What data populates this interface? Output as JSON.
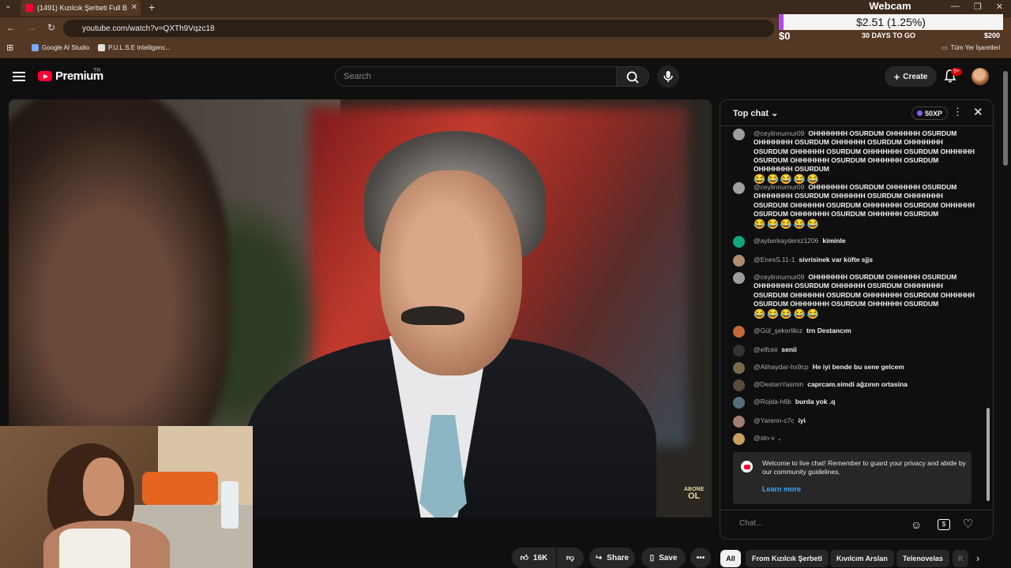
{
  "browser": {
    "tab_title": "(1491) Kızılcık Şerbeti Full B",
    "url": "youtube.com/watch?v=QXTh9Vqzc18",
    "bookmarks": [
      {
        "label": "Google AI Studio"
      },
      {
        "label": "P.U.L.S.E Intelligenc..."
      }
    ],
    "all_bookmarks_label": "Tüm Yer İşaretleri"
  },
  "webcam_overlay": {
    "title": "Webcam",
    "goal_text": "$2.51 (1.25%)",
    "goal_min": "$0",
    "goal_days": "30 DAYS TO GO",
    "goal_max": "$200",
    "goal_progress": 0.0125
  },
  "youtube": {
    "logo_text": "Premium",
    "country_code": "TR",
    "search_placeholder": "Search",
    "create_label": "Create",
    "notification_count": "9+"
  },
  "video": {
    "watermark_top": "ABONE",
    "watermark_bottom": "OL"
  },
  "actions": {
    "likes": "16K",
    "share": "Share",
    "save": "Save"
  },
  "chat": {
    "title": "Top chat",
    "xp": "50XP",
    "messages": [
      {
        "author": "@ceylinnurnur09",
        "text": "OHHHHHHH OSURDUM OHHHHHH OSURDUM OHHHHHHH OSURDUM OHHHHHH OSURDUM OHHHHHHH OSURDUM OHHHHHH OSURDUM OHHHHHHH OSURDUM OHHHHHH OSURDUM OHHHHHHH OSURDUM OHHHHHH OSURDUM OHHHHHHH OSURDUM",
        "emoji": "😂😂😂😂😂",
        "avatar_color": "#9e9e9e"
      },
      {
        "author": "@ceylinnurnur09",
        "text": "OHHHHHHH OSURDUM OHHHHHH OSURDUM OHHHHHHH OSURDUM OHHHHHH OSURDUM OHHHHHHH OSURDUM OHHHHHH OSURDUM OHHHHHHH OSURDUM OHHHHHH OSURDUM OHHHHHHH OSURDUM OHHHHHH OSURDUM",
        "emoji": "😂😂😂😂😂",
        "avatar_color": "#9e9e9e"
      },
      {
        "author": "@ayberkaydeniz1206",
        "text": "kiminle",
        "emoji": "",
        "avatar_color": "#12a37f"
      },
      {
        "author": "@EnesS.11-1",
        "text": "sivrisinek var köfte sjjs",
        "emoji": "",
        "avatar_color": "#b08c6e"
      },
      {
        "author": "@ceylinnurnur09",
        "text": "OHHHHHHH OSURDUM OHHHHHH OSURDUM OHHHHHHH OSURDUM OHHHHHH OSURDUM OHHHHHHH OSURDUM OHHHHHH OSURDUM OHHHHHHH OSURDUM OHHHHHH OSURDUM OHHHHHHH OSURDUM OHHHHHH OSURDUM",
        "emoji": "😂😂😂😂😂",
        "avatar_color": "#9e9e9e"
      },
      {
        "author": "@Gül_şekerlikız",
        "text": "trn Destancım",
        "emoji": "",
        "avatar_color": "#c46a3a"
      },
      {
        "author": "@elfceii",
        "text": "senii",
        "emoji": "",
        "avatar_color": "#333333"
      },
      {
        "author": "@Alihaydar-hx9cp",
        "text": "He iyi bende bu sene gelcem",
        "emoji": "",
        "avatar_color": "#7a6a4a"
      },
      {
        "author": "@DestanYasmin",
        "text": "caprcam.simdi ağzının ortasina",
        "emoji": "",
        "avatar_color": "#5a4a3a"
      },
      {
        "author": "@Rojda-h6b",
        "text": "burda yok .q",
        "emoji": "",
        "avatar_color": "#546e7a"
      },
      {
        "author": "@Yarenn-c7c",
        "text": "iyi",
        "emoji": "",
        "avatar_color": "#a08070"
      },
      {
        "author": "@sln-v",
        "text": ".",
        "emoji": "",
        "avatar_color": "#c9a060"
      }
    ],
    "welcome_text": "Welcome to live chat! Remember to guard your privacy and abide by our community guidelines.",
    "learn_more": "Learn more",
    "input_placeholder": "Chat..."
  },
  "chips": [
    "All",
    "From Kızılcık Şerbeti",
    "Kıvılcım Arslan",
    "Telenovelas",
    "R"
  ]
}
